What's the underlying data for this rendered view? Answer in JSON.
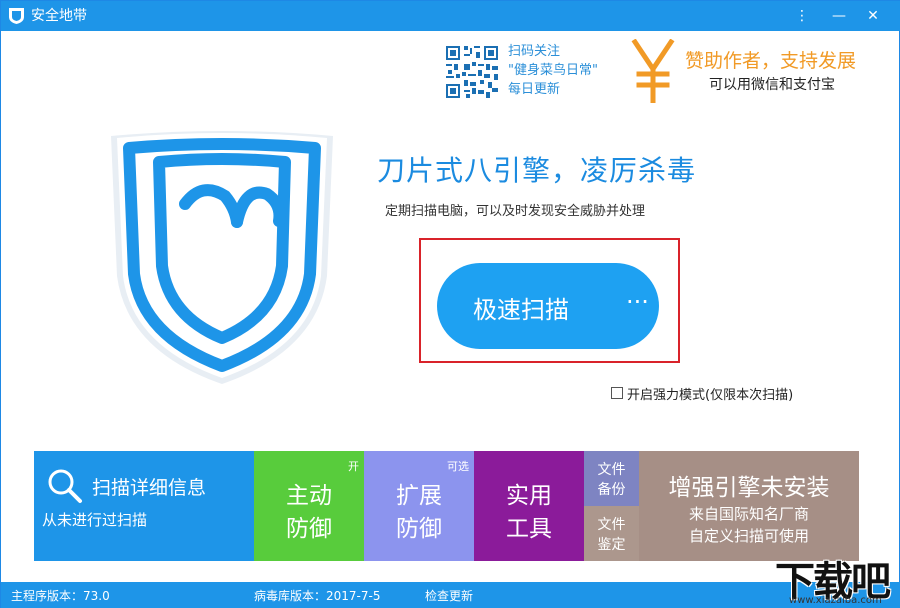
{
  "window": {
    "title": "安全地带",
    "menu_glyph": "⋮",
    "min_glyph": "—",
    "close_glyph": "✕"
  },
  "promo": {
    "qr_line1": "扫码关注",
    "qr_line2": "\"健身菜鸟日常\"",
    "qr_line3": "每日更新",
    "donate_title": "赞助作者，支持发展",
    "donate_sub": "可以用微信和支付宝"
  },
  "main": {
    "headline": "刀片式八引擎，凌厉杀毒",
    "subline": "定期扫描电脑，可以及时发现安全威胁并处理",
    "scan_button": "极速扫描",
    "scan_more": "···",
    "strong_mode_label": "开启强力模式(仅限本次扫描)",
    "strong_mode_checked": false
  },
  "tiles": {
    "scan_info_title": "扫描详细信息",
    "scan_info_status": "从未进行过扫描",
    "active_defense_l1": "主动",
    "active_defense_l2": "防御",
    "active_defense_badge": "开",
    "ext_defense_l1": "扩展",
    "ext_defense_l2": "防御",
    "ext_defense_badge": "可选",
    "tools_l1": "实用",
    "tools_l2": "工具",
    "backup_l1": "文件",
    "backup_l2": "备份",
    "verify_l1": "文件",
    "verify_l2": "鉴定",
    "engine_title": "增强引擎未安装",
    "engine_sub1": "来自国际知名厂商",
    "engine_sub2": "自定义扫描可使用"
  },
  "status": {
    "program_version": "主程序版本：73.0",
    "virus_db_version": "病毒库版本：2017-7-5",
    "check_update": "检查更新"
  },
  "watermark": {
    "text": "下载吧",
    "url": "www.xiazaiba.com"
  },
  "colors": {
    "titlebar": "#1e95e8",
    "scan_button": "#1ea1f2",
    "highlight": "#d9232a",
    "tile_scan": "#1e95e8",
    "tile_active": "#58cc3c",
    "tile_ext": "#8c94ee",
    "tile_tools": "#8b1b9a",
    "tile_backup": "#7e84c2",
    "tile_verify": "#ac978d",
    "tile_engine": "#a68f86",
    "donate": "#f19a26"
  },
  "icons": [
    "shield-logo-icon",
    "qr-code-icon",
    "yen-icon",
    "search-icon"
  ]
}
